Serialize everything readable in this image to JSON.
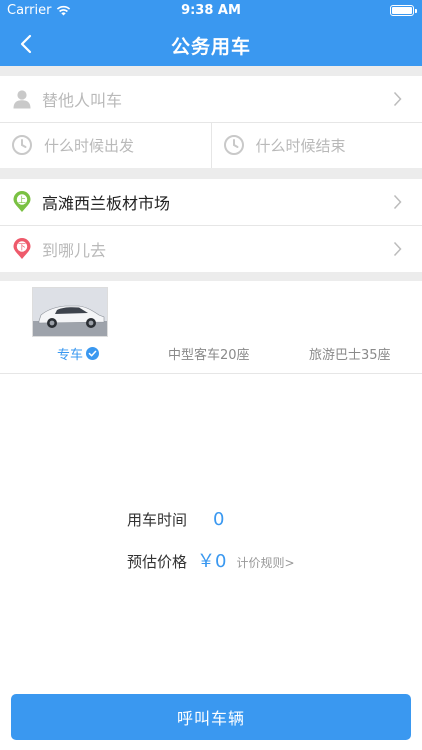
{
  "status_bar": {
    "carrier": "Carrier",
    "time": "9:38 AM"
  },
  "header": {
    "title": "公务用车"
  },
  "form": {
    "passenger_placeholder": "替他人叫车",
    "start_time_placeholder": "什么时候出发",
    "end_time_placeholder": "什么时候结束",
    "pickup_badge": "上",
    "pickup_value": "高滩西兰板材市场",
    "dropoff_badge": "下",
    "dropoff_placeholder": "到哪儿去"
  },
  "car_types": [
    {
      "label": "专车",
      "selected": true
    },
    {
      "label": "中型客车20座",
      "selected": false
    },
    {
      "label": "旅游巴士35座",
      "selected": false
    }
  ],
  "summary": {
    "duration_label": "用车时间",
    "duration_value": "0",
    "price_label": "预估价格",
    "price_value": "￥0",
    "rules_link": "计价规则>"
  },
  "actions": {
    "call_button": "呼叫车辆"
  },
  "colors": {
    "primary": "#3a98f0",
    "pickup": "#7ac143",
    "dropoff": "#ee5a6b"
  },
  "icons": [
    "back-icon",
    "wifi-icon",
    "battery-icon",
    "person-icon",
    "clock-icon",
    "pickup-pin-icon",
    "dropoff-pin-icon",
    "chevron-right-icon",
    "check-circle-icon"
  ]
}
